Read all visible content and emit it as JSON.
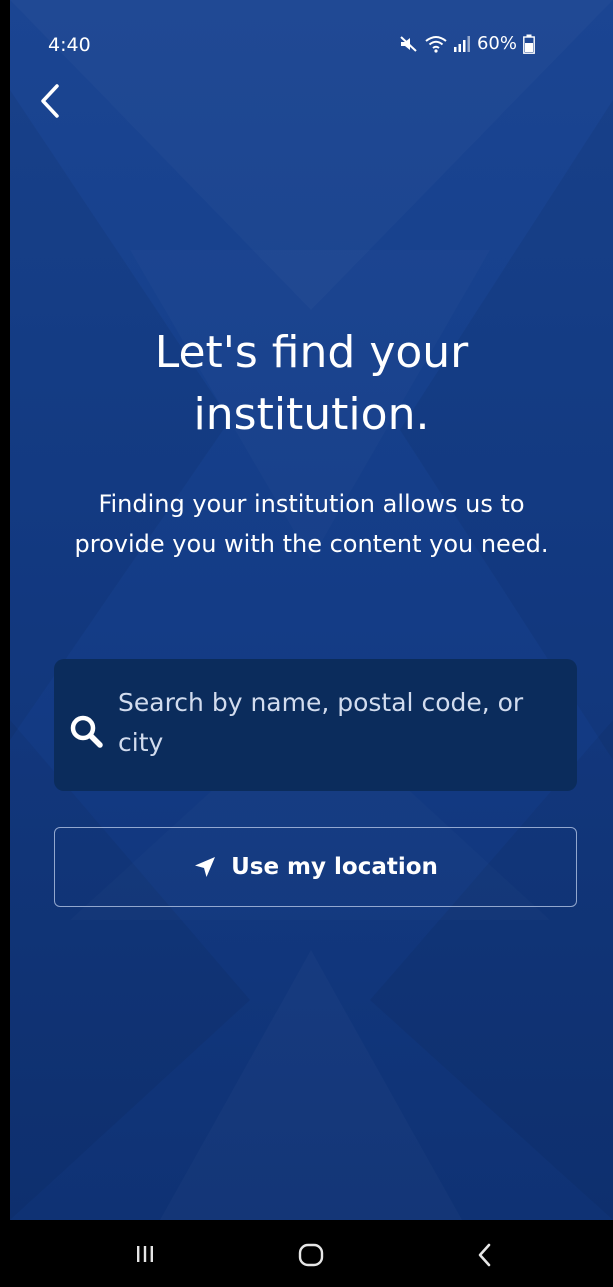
{
  "status_bar": {
    "time": "4:40",
    "battery_percent": "60%",
    "icons": [
      "mute-icon",
      "wifi-icon",
      "signal-icon",
      "battery-icon"
    ]
  },
  "header": {
    "back_icon": "chevron-left-icon"
  },
  "main": {
    "title": "Let's find your institution.",
    "subtitle": "Finding your institution allows us to provide you with the content you need.",
    "search": {
      "placeholder": "Search by name, postal code, or city",
      "icon": "search-icon"
    },
    "location_button": {
      "label": "Use my location",
      "icon": "location-arrow-icon"
    }
  },
  "nav_bar": {
    "items": [
      "recents-icon",
      "home-icon",
      "back-icon"
    ]
  },
  "colors": {
    "background_top": "#1b4592",
    "background_bottom": "#0f3274",
    "search_box": "#0b2c5c",
    "text": "#ffffff"
  }
}
